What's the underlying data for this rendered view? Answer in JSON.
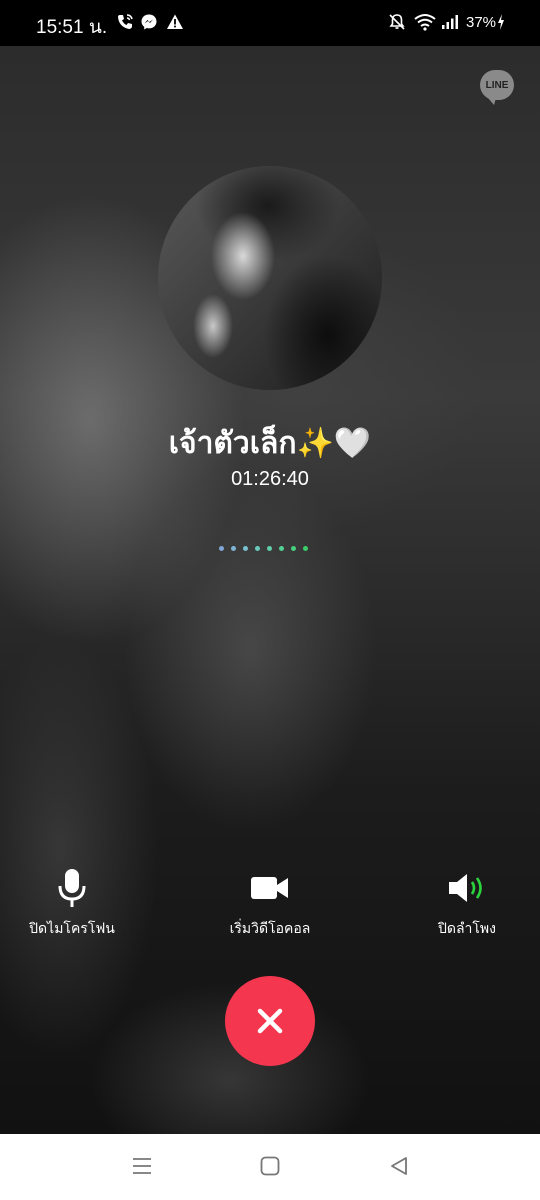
{
  "status_bar": {
    "time": "15:51 น.",
    "battery": "37%",
    "icons": [
      "phone-wifi-icon",
      "messenger-icon",
      "warning-icon",
      "bell-off-icon",
      "wifi-icon",
      "signal-icon",
      "charging-icon"
    ]
  },
  "brand": {
    "logo_text": "LINE"
  },
  "call": {
    "contact_name": "เจ้าตัวเล็ก✨🤍",
    "timer": "01:26:40",
    "indicator_colors": [
      "#7fa6d6",
      "#7fb3d6",
      "#79c1cf",
      "#6cc9bd",
      "#5fcfa9",
      "#52d093",
      "#46cf7d",
      "#3ccc6a"
    ]
  },
  "controls": {
    "mute_label": "ปิดไมโครโฟน",
    "video_label": "เริ่มวิดีโอคอล",
    "speaker_label": "ปิดลำโพง",
    "speaker_active_color": "#2bd33d",
    "end_call_color": "#f5364f"
  },
  "nav": {
    "buttons": [
      "recent-apps",
      "home",
      "back"
    ]
  }
}
